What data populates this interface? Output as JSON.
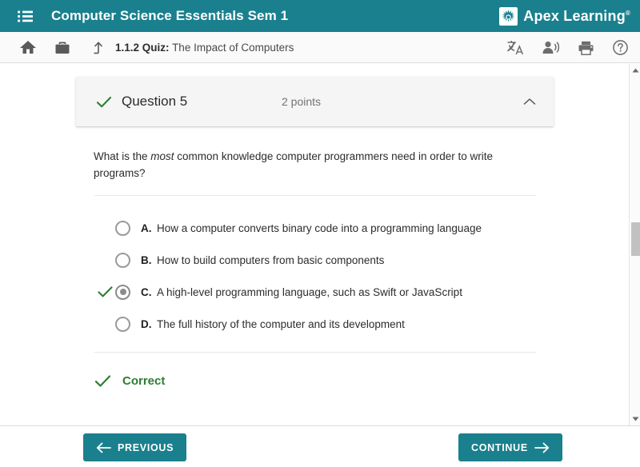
{
  "header": {
    "menu_icon": "list-menu-icon",
    "course_title": "Computer Science Essentials Sem 1",
    "brand_name": "Apex Learning",
    "brand_tm": "®",
    "brand_mark_icon": "apex-torch-logo-icon",
    "teal": "#1a808e"
  },
  "breadcrumb": {
    "home_icon": "home-icon",
    "briefcase_icon": "briefcase-icon",
    "up_icon": "arrow-up-level-icon",
    "number": "1.1.2",
    "kind": "Quiz:",
    "name": "The Impact of Computers",
    "tools": [
      {
        "icon": "translate-icon",
        "name": "translate-tool"
      },
      {
        "icon": "read-aloud-icon",
        "name": "read-aloud-tool"
      },
      {
        "icon": "print-icon",
        "name": "print-tool"
      },
      {
        "icon": "help-icon",
        "name": "help-tool"
      }
    ]
  },
  "question_card": {
    "status_icon": "check-icon",
    "label": "Question 5",
    "points": "2 points",
    "collapse_icon": "chevron-up-icon"
  },
  "question": {
    "text_before": "What is the ",
    "emphasis": "most",
    "text_after": " common knowledge computer programmers need in order to write programs?"
  },
  "options": [
    {
      "letter": "A.",
      "text": "How a computer converts binary code into a programming language",
      "selected": false,
      "correct_mark": false
    },
    {
      "letter": "B.",
      "text": "How to build computers from basic components",
      "selected": false,
      "correct_mark": false
    },
    {
      "letter": "C.",
      "text": "A high-level programming language, such as Swift or JavaScript",
      "selected": true,
      "correct_mark": true
    },
    {
      "letter": "D.",
      "text": "The full history of the computer and its development",
      "selected": false,
      "correct_mark": false
    }
  ],
  "feedback": {
    "icon": "check-icon",
    "text": "Correct",
    "color": "#2e7d32"
  },
  "footer": {
    "previous_label": "PREVIOUS",
    "previous_icon": "arrow-left-icon",
    "continue_label": "CONTINUE",
    "continue_icon": "arrow-right-icon"
  },
  "scrollbar": {
    "up_icon": "triangle-up-icon",
    "down_icon": "triangle-down-icon"
  }
}
